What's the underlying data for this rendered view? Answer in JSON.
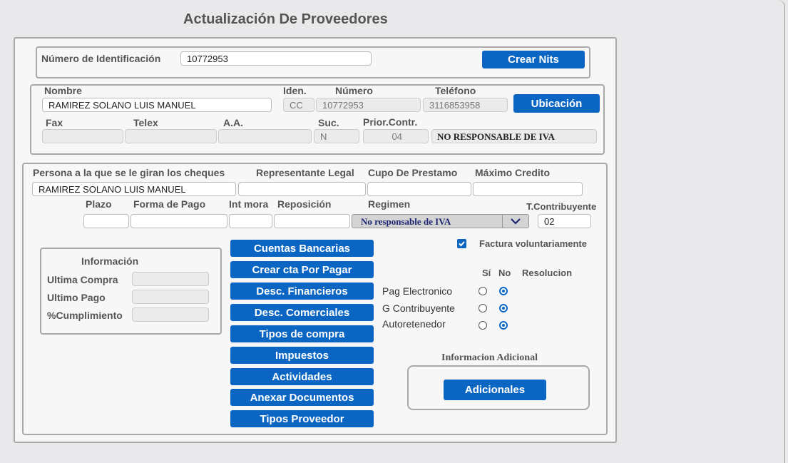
{
  "title": "Actualización De Proveedores",
  "identification": {
    "label": "Número de Identificación",
    "value": "10772953",
    "create_button": "Crear Nits"
  },
  "contact": {
    "name_label": "Nombre",
    "name_value": "RAMIREZ SOLANO LUIS MANUEL",
    "iden_label": "Iden.",
    "iden_value": "CC",
    "numero_label": "Número",
    "numero_value": "10772953",
    "telefono_label": "Teléfono",
    "telefono_value": "3116853958",
    "ubicacion_button": "Ubicación",
    "fax_label": "Fax",
    "telex_label": "Telex",
    "aa_label": "A.A.",
    "suc_label": "Suc.",
    "suc_value": "N",
    "prior_label": "Prior.Contr.",
    "prior_value": "04",
    "iva_value": "NO RESPONSABLE DE IVA"
  },
  "payment": {
    "persona_label": "Persona  a la que se le giran los cheques",
    "persona_value": "RAMIREZ SOLANO LUIS MANUEL",
    "representante_label": "Representante Legal",
    "cupo_label": "Cupo De Prestamo",
    "maximo_label": "Máximo Credito",
    "plazo_label": "Plazo",
    "forma_label": "Forma de Pago",
    "intmora_label": "Int mora",
    "reposicion_label": "Reposición",
    "regimen_label": "Regimen",
    "regimen_value": "No responsable de IVA",
    "tcontrib_label": "T.Contribuyente",
    "tcontrib_value": "02"
  },
  "info": {
    "title": "Información",
    "ultima_compra": "Ultima Compra",
    "ultimo_pago": "Ultimo Pago",
    "cumplimiento": "%Cumplimiento"
  },
  "actions": [
    "Cuentas Bancarias",
    "Crear cta Por Pagar",
    "Desc. Financieros",
    "Desc. Comerciales",
    "Tipos de compra",
    "Impuestos",
    "Actividades",
    "Anexar Documentos",
    "Tipos Proveedor"
  ],
  "options": {
    "factura_label": "Factura voluntariamente",
    "si": "Sí",
    "no": "No",
    "resolucion": "Resolucion",
    "rows": [
      "Pag Electronico",
      "G Contribuyente",
      "Autoretenedor"
    ]
  },
  "additional": {
    "title": "Informacion Adicional",
    "button": "Adicionales"
  }
}
